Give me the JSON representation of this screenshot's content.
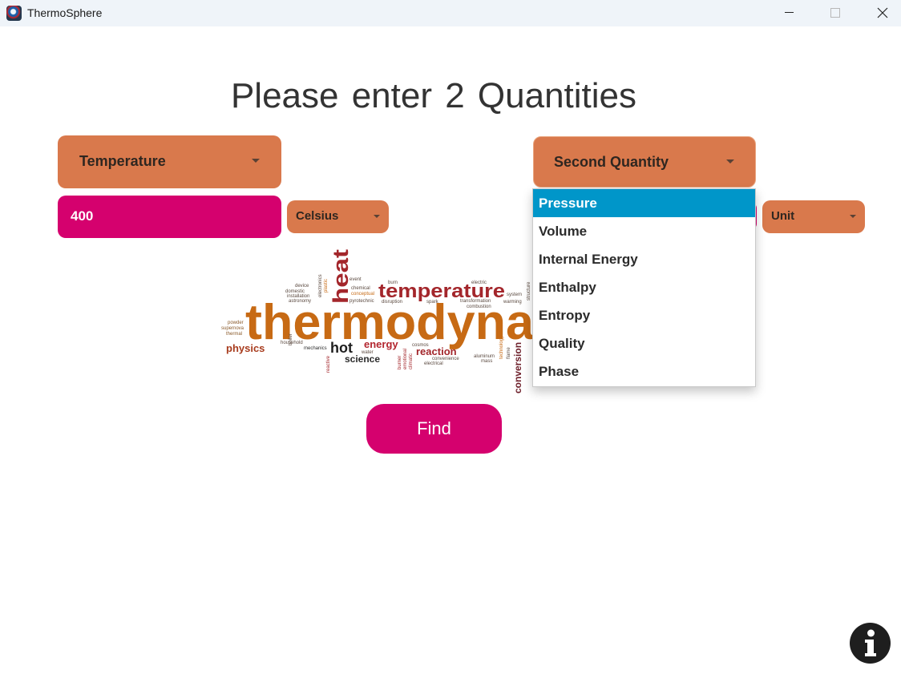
{
  "window": {
    "title": "ThermoSphere",
    "icons": {
      "app": "thermosphere-app-icon",
      "minimize": "minimize-icon",
      "maximize": "maximize-icon",
      "close": "close-icon"
    }
  },
  "heading": "Please enter  2  Quantities",
  "first_quantity": {
    "selected": "Temperature",
    "value": "400",
    "unit": "Celsius"
  },
  "second_quantity": {
    "selected": "Second Quantity",
    "unit": "Unit",
    "dropdown_open": true,
    "options": [
      "Pressure",
      "Volume",
      "Internal Energy",
      "Enthalpy",
      "Entropy",
      "Quality",
      "Phase"
    ],
    "highlighted_option": "Pressure"
  },
  "word_cloud": {
    "words": [
      "thermodyna",
      "heat",
      "temperature",
      "physics",
      "hot",
      "science",
      "energy",
      "reaction",
      "conversion",
      "device",
      "domestic",
      "installation",
      "astronomy",
      "powder",
      "supernova",
      "thermal",
      "event",
      "chemical",
      "conceptual",
      "pyrotechnic",
      "burn",
      "disruption",
      "spark",
      "electric",
      "transformation",
      "combustion",
      "system",
      "warming",
      "structure",
      "household",
      "mechanics",
      "water",
      "cosmos",
      "convenience",
      "electrical",
      "aluminum",
      "mass",
      "flame",
      "technology",
      "reactive",
      "burner",
      "emotional",
      "climatic",
      "boiler",
      "electronics",
      "plastic"
    ]
  },
  "actions": {
    "find_label": "Find"
  },
  "icons": {
    "info": "info-icon",
    "chevron": "chevron-down-icon"
  },
  "colors": {
    "combo": "#d9794c",
    "input": "#d5016e",
    "find": "#d5016e",
    "selected_option": "#0096c9",
    "titlebar": "#eff4f9"
  }
}
